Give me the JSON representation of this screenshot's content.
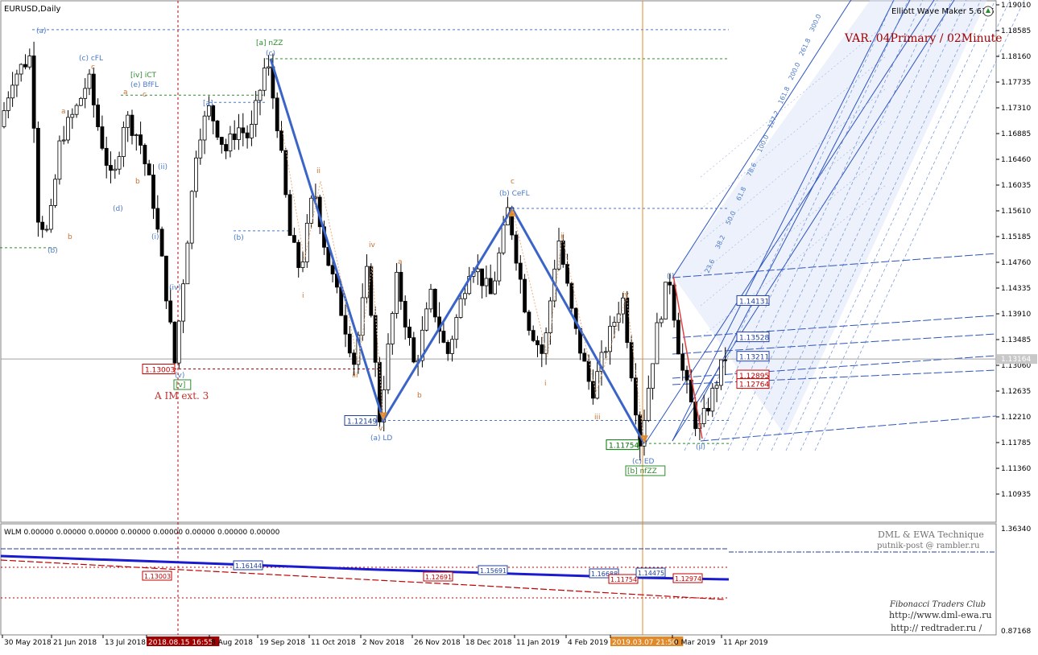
{
  "chart_data": {
    "type": "candlestick",
    "symbol_label": "EURUSD,Daily",
    "indicator_label": "Elliott Wave Maker 5.61.5",
    "variant_label": "VAR. 04Primary / 02Minute",
    "price_axis": {
      "ylim": [
        1.088,
        1.192
      ],
      "ticks": [
        "1.19010",
        "1.18585",
        "1.18160",
        "1.17735",
        "1.17310",
        "1.16885",
        "1.16460",
        "1.16035",
        "1.15610",
        "1.15185",
        "1.14760",
        "1.14335",
        "1.13910",
        "1.13485",
        "1.13060",
        "1.12635",
        "1.12210",
        "1.11785",
        "1.11360",
        "1.10935"
      ],
      "current_price": "1.13164"
    },
    "x_axis": {
      "labels": [
        "30 May 2018",
        "21 Jun 2018",
        "13 Jul 2018",
        "2018.08.15 16:55",
        "8 Aug 2018",
        "19 Sep 2018",
        "11 Oct 2018",
        "2 Nov 2018",
        "26 Nov 2018",
        "18 Dec 2018",
        "11 Jan 2019",
        "4 Feb 2019",
        "2019.03.07 21:50",
        "0 Mar 2019",
        "11 Apr 2019"
      ],
      "highlighted": [
        "2018.08.15 16:55",
        "2019.03.07 21:50"
      ]
    },
    "price_boxes": [
      {
        "text": "1.13003",
        "price": 1.13,
        "color": "#c00000"
      },
      {
        "text": "1.12149",
        "price": 1.1215,
        "color": "#1f3fa0"
      },
      {
        "text": "1.11754",
        "price": 1.1175,
        "color": "#007000"
      },
      {
        "text": "1.14131",
        "price": 1.1413,
        "color": "#1f3fa0"
      },
      {
        "text": "1.13528",
        "price": 1.1353,
        "color": "#1f3fa0"
      },
      {
        "text": "1.13211",
        "price": 1.1321,
        "color": "#1f3fa0"
      },
      {
        "text": "1.12895",
        "price": 1.129,
        "color": "#c00000"
      },
      {
        "text": "1.12764",
        "price": 1.1276,
        "color": "#c00000"
      }
    ],
    "wave_labels": [
      {
        "text": "(a)",
        "color": "#4a78c8"
      },
      {
        "text": "(c) cFL",
        "color": "#4a78c8"
      },
      {
        "text": "[iv] iCT",
        "color": "#2e8b2e"
      },
      {
        "text": "(e) BfFL",
        "color": "#4a78c8"
      },
      {
        "text": "[a] nZZ",
        "color": "#2e8b2e"
      },
      {
        "text": "(c)",
        "color": "#4a78c8"
      },
      {
        "text": "[a]",
        "color": "#4a78c8"
      },
      {
        "text": "(b) CeFL",
        "color": "#4a78c8"
      },
      {
        "text": "(a) LD",
        "color": "#4a78c8"
      },
      {
        "text": "(c) ED",
        "color": "#4a78c8"
      },
      {
        "text": "[b] nfZZ",
        "color": "#2e8b2e"
      },
      {
        "text": "A IM ext. 3",
        "color": "#c03030"
      },
      {
        "text": "(b)",
        "color": "#4a78c8"
      },
      {
        "text": "(d)",
        "color": "#4a78c8"
      },
      {
        "text": "(i)",
        "color": "#4a78c8"
      },
      {
        "text": "(ii)",
        "color": "#4a78c8"
      },
      {
        "text": "(iv)",
        "color": "#4a78c8"
      },
      {
        "text": "(v)",
        "color": "#4a78c8"
      },
      {
        "text": "[v]",
        "color": "#2e8b2e"
      },
      {
        "text": "ii",
        "color": "#c87030"
      },
      {
        "text": "iii",
        "color": "#c87030"
      },
      {
        "text": "iv",
        "color": "#c87030"
      },
      {
        "text": "v",
        "color": "#c87030"
      },
      {
        "text": "a",
        "color": "#c87030"
      },
      {
        "text": "b",
        "color": "#c87030"
      },
      {
        "text": "c",
        "color": "#c87030"
      },
      {
        "text": "i",
        "color": "#c87030"
      }
    ],
    "zigzag": [
      {
        "label": "(c)",
        "price": 1.1812
      },
      {
        "label": "(a) LD",
        "price": 1.1215
      },
      {
        "label": "(b) CeFL",
        "price": 1.1565
      },
      {
        "label": "(c) ED",
        "price": 1.1177
      }
    ],
    "fib_channel_labels": [
      "300.0",
      "261.8",
      "200.0",
      "161.8",
      "127.2",
      "100.0",
      "78.6",
      "61.8",
      "50.0",
      "38.2",
      "23.6"
    ],
    "sub_window": {
      "label": "WLM 0.00000 0.00000 0.00000 0.00000 0.00000 0.00000 0.00000 0.00000",
      "ticks": [
        "1.36340",
        "0.87168"
      ],
      "boxes": [
        "1.13003",
        "1.16144",
        "1.12691",
        "1.15691",
        "1.16688",
        "1.11754",
        "1.14475",
        "1.12974"
      ],
      "watermark": [
        "DML & EWA Technique",
        "putnik-post @ rambler.ru",
        "Fibonacci   Traders   Club",
        "http://www.dml-ewa.ru",
        "http://  redtrader.ru  /"
      ]
    },
    "colors": {
      "zigzag": "#3a64c8",
      "channel": "#2d55c0",
      "red": "#c00000",
      "green": "#007000",
      "orange": "#e08a2a",
      "candles": "#000000"
    }
  }
}
